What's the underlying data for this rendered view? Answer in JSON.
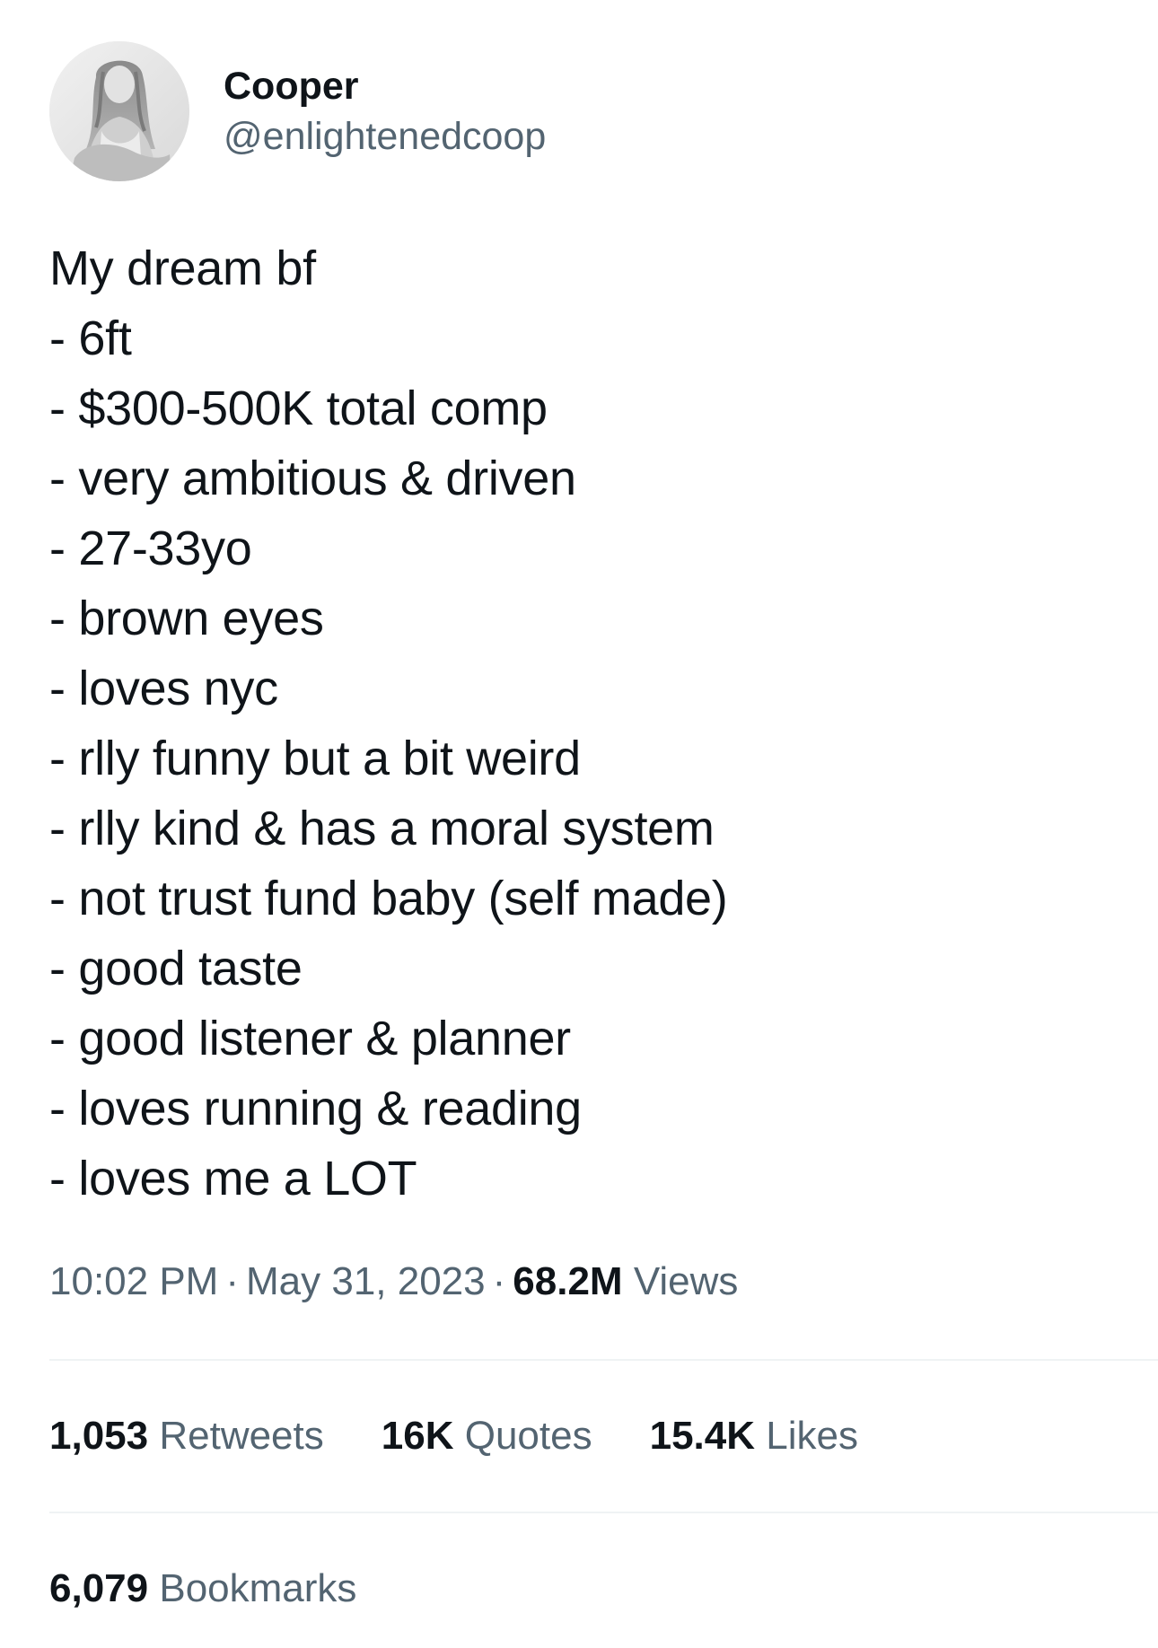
{
  "user": {
    "display_name": "Cooper",
    "handle": "@enlightenedcoop",
    "avatar_icon": "profile-photo-grayscale"
  },
  "tweet": {
    "lines": [
      "My dream bf",
      "- 6ft",
      "- $300-500K total comp",
      "- very ambitious & driven",
      "- 27-33yo",
      "- brown eyes",
      "- loves nyc",
      "- rlly funny but a bit weird",
      "- rlly kind & has a moral system",
      "- not trust fund baby (self made)",
      "- good taste",
      "- good listener & planner",
      "- loves running & reading",
      "- loves me a LOT"
    ]
  },
  "meta": {
    "time": "10:02 PM",
    "separator": "·",
    "date": "May 31, 2023",
    "views_count": "68.2M",
    "views_label": "Views"
  },
  "stats": {
    "retweets": {
      "count": "1,053",
      "label": "Retweets"
    },
    "quotes": {
      "count": "16K",
      "label": "Quotes"
    },
    "likes": {
      "count": "15.4K",
      "label": "Likes"
    },
    "bookmarks": {
      "count": "6,079",
      "label": "Bookmarks"
    }
  },
  "colors": {
    "text_primary": "#0f1419",
    "text_secondary": "#536471",
    "divider": "#eff3f4"
  }
}
